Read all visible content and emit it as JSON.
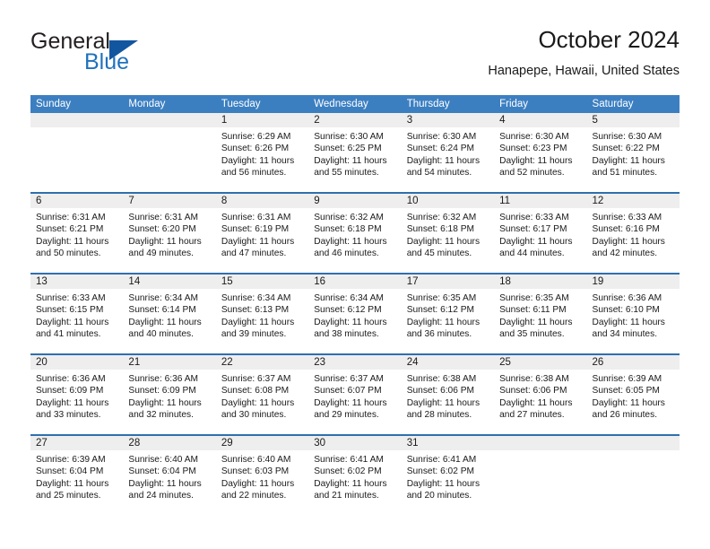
{
  "brand": {
    "word1": "General",
    "word2": "Blue",
    "flag_icon": "triangle-flag-icon",
    "color_dark": "#231f20",
    "color_blue": "#1f72bd"
  },
  "header": {
    "title": "October 2024",
    "location": "Hanapepe, Hawaii, United States"
  },
  "theme": {
    "header_blue": "#3c7fc1",
    "separator_blue": "#2f6fae",
    "daynum_gray": "#efeeee"
  },
  "weekdays": [
    "Sunday",
    "Monday",
    "Tuesday",
    "Wednesday",
    "Thursday",
    "Friday",
    "Saturday"
  ],
  "weeks": [
    [
      {
        "day": "",
        "sunrise": "",
        "sunset": "",
        "daylight1": "",
        "daylight2": ""
      },
      {
        "day": "",
        "sunrise": "",
        "sunset": "",
        "daylight1": "",
        "daylight2": ""
      },
      {
        "day": "1",
        "sunrise": "Sunrise: 6:29 AM",
        "sunset": "Sunset: 6:26 PM",
        "daylight1": "Daylight: 11 hours",
        "daylight2": "and 56 minutes."
      },
      {
        "day": "2",
        "sunrise": "Sunrise: 6:30 AM",
        "sunset": "Sunset: 6:25 PM",
        "daylight1": "Daylight: 11 hours",
        "daylight2": "and 55 minutes."
      },
      {
        "day": "3",
        "sunrise": "Sunrise: 6:30 AM",
        "sunset": "Sunset: 6:24 PM",
        "daylight1": "Daylight: 11 hours",
        "daylight2": "and 54 minutes."
      },
      {
        "day": "4",
        "sunrise": "Sunrise: 6:30 AM",
        "sunset": "Sunset: 6:23 PM",
        "daylight1": "Daylight: 11 hours",
        "daylight2": "and 52 minutes."
      },
      {
        "day": "5",
        "sunrise": "Sunrise: 6:30 AM",
        "sunset": "Sunset: 6:22 PM",
        "daylight1": "Daylight: 11 hours",
        "daylight2": "and 51 minutes."
      }
    ],
    [
      {
        "day": "6",
        "sunrise": "Sunrise: 6:31 AM",
        "sunset": "Sunset: 6:21 PM",
        "daylight1": "Daylight: 11 hours",
        "daylight2": "and 50 minutes."
      },
      {
        "day": "7",
        "sunrise": "Sunrise: 6:31 AM",
        "sunset": "Sunset: 6:20 PM",
        "daylight1": "Daylight: 11 hours",
        "daylight2": "and 49 minutes."
      },
      {
        "day": "8",
        "sunrise": "Sunrise: 6:31 AM",
        "sunset": "Sunset: 6:19 PM",
        "daylight1": "Daylight: 11 hours",
        "daylight2": "and 47 minutes."
      },
      {
        "day": "9",
        "sunrise": "Sunrise: 6:32 AM",
        "sunset": "Sunset: 6:18 PM",
        "daylight1": "Daylight: 11 hours",
        "daylight2": "and 46 minutes."
      },
      {
        "day": "10",
        "sunrise": "Sunrise: 6:32 AM",
        "sunset": "Sunset: 6:18 PM",
        "daylight1": "Daylight: 11 hours",
        "daylight2": "and 45 minutes."
      },
      {
        "day": "11",
        "sunrise": "Sunrise: 6:33 AM",
        "sunset": "Sunset: 6:17 PM",
        "daylight1": "Daylight: 11 hours",
        "daylight2": "and 44 minutes."
      },
      {
        "day": "12",
        "sunrise": "Sunrise: 6:33 AM",
        "sunset": "Sunset: 6:16 PM",
        "daylight1": "Daylight: 11 hours",
        "daylight2": "and 42 minutes."
      }
    ],
    [
      {
        "day": "13",
        "sunrise": "Sunrise: 6:33 AM",
        "sunset": "Sunset: 6:15 PM",
        "daylight1": "Daylight: 11 hours",
        "daylight2": "and 41 minutes."
      },
      {
        "day": "14",
        "sunrise": "Sunrise: 6:34 AM",
        "sunset": "Sunset: 6:14 PM",
        "daylight1": "Daylight: 11 hours",
        "daylight2": "and 40 minutes."
      },
      {
        "day": "15",
        "sunrise": "Sunrise: 6:34 AM",
        "sunset": "Sunset: 6:13 PM",
        "daylight1": "Daylight: 11 hours",
        "daylight2": "and 39 minutes."
      },
      {
        "day": "16",
        "sunrise": "Sunrise: 6:34 AM",
        "sunset": "Sunset: 6:12 PM",
        "daylight1": "Daylight: 11 hours",
        "daylight2": "and 38 minutes."
      },
      {
        "day": "17",
        "sunrise": "Sunrise: 6:35 AM",
        "sunset": "Sunset: 6:12 PM",
        "daylight1": "Daylight: 11 hours",
        "daylight2": "and 36 minutes."
      },
      {
        "day": "18",
        "sunrise": "Sunrise: 6:35 AM",
        "sunset": "Sunset: 6:11 PM",
        "daylight1": "Daylight: 11 hours",
        "daylight2": "and 35 minutes."
      },
      {
        "day": "19",
        "sunrise": "Sunrise: 6:36 AM",
        "sunset": "Sunset: 6:10 PM",
        "daylight1": "Daylight: 11 hours",
        "daylight2": "and 34 minutes."
      }
    ],
    [
      {
        "day": "20",
        "sunrise": "Sunrise: 6:36 AM",
        "sunset": "Sunset: 6:09 PM",
        "daylight1": "Daylight: 11 hours",
        "daylight2": "and 33 minutes."
      },
      {
        "day": "21",
        "sunrise": "Sunrise: 6:36 AM",
        "sunset": "Sunset: 6:09 PM",
        "daylight1": "Daylight: 11 hours",
        "daylight2": "and 32 minutes."
      },
      {
        "day": "22",
        "sunrise": "Sunrise: 6:37 AM",
        "sunset": "Sunset: 6:08 PM",
        "daylight1": "Daylight: 11 hours",
        "daylight2": "and 30 minutes."
      },
      {
        "day": "23",
        "sunrise": "Sunrise: 6:37 AM",
        "sunset": "Sunset: 6:07 PM",
        "daylight1": "Daylight: 11 hours",
        "daylight2": "and 29 minutes."
      },
      {
        "day": "24",
        "sunrise": "Sunrise: 6:38 AM",
        "sunset": "Sunset: 6:06 PM",
        "daylight1": "Daylight: 11 hours",
        "daylight2": "and 28 minutes."
      },
      {
        "day": "25",
        "sunrise": "Sunrise: 6:38 AM",
        "sunset": "Sunset: 6:06 PM",
        "daylight1": "Daylight: 11 hours",
        "daylight2": "and 27 minutes."
      },
      {
        "day": "26",
        "sunrise": "Sunrise: 6:39 AM",
        "sunset": "Sunset: 6:05 PM",
        "daylight1": "Daylight: 11 hours",
        "daylight2": "and 26 minutes."
      }
    ],
    [
      {
        "day": "27",
        "sunrise": "Sunrise: 6:39 AM",
        "sunset": "Sunset: 6:04 PM",
        "daylight1": "Daylight: 11 hours",
        "daylight2": "and 25 minutes."
      },
      {
        "day": "28",
        "sunrise": "Sunrise: 6:40 AM",
        "sunset": "Sunset: 6:04 PM",
        "daylight1": "Daylight: 11 hours",
        "daylight2": "and 24 minutes."
      },
      {
        "day": "29",
        "sunrise": "Sunrise: 6:40 AM",
        "sunset": "Sunset: 6:03 PM",
        "daylight1": "Daylight: 11 hours",
        "daylight2": "and 22 minutes."
      },
      {
        "day": "30",
        "sunrise": "Sunrise: 6:41 AM",
        "sunset": "Sunset: 6:02 PM",
        "daylight1": "Daylight: 11 hours",
        "daylight2": "and 21 minutes."
      },
      {
        "day": "31",
        "sunrise": "Sunrise: 6:41 AM",
        "sunset": "Sunset: 6:02 PM",
        "daylight1": "Daylight: 11 hours",
        "daylight2": "and 20 minutes."
      },
      {
        "day": "",
        "sunrise": "",
        "sunset": "",
        "daylight1": "",
        "daylight2": ""
      },
      {
        "day": "",
        "sunrise": "",
        "sunset": "",
        "daylight1": "",
        "daylight2": ""
      }
    ]
  ]
}
